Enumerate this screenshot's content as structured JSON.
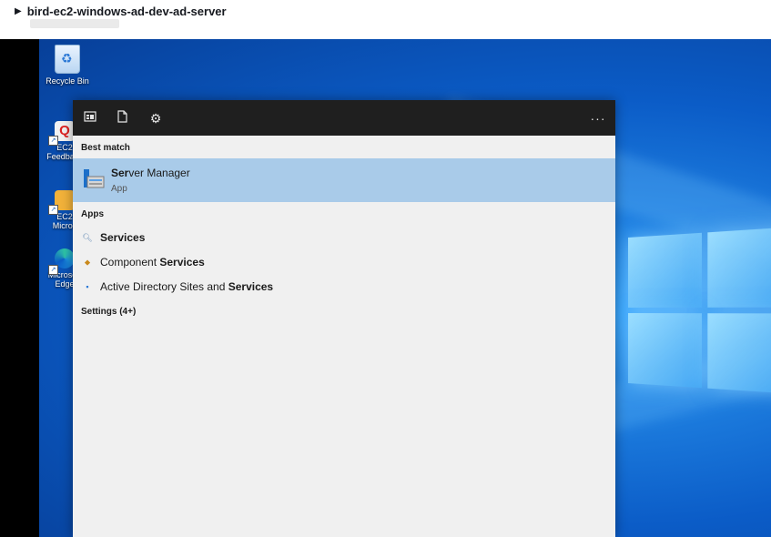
{
  "header": {
    "title": "bird-ec2-windows-ad-dev-ad-server"
  },
  "desktop": {
    "icons": [
      {
        "label": "Recycle Bin"
      },
      {
        "label": "EC2 Feedback"
      },
      {
        "label": "EC2 Micros"
      },
      {
        "label": "Microsoft Edge"
      }
    ]
  },
  "search_panel": {
    "best_match_heading": "Best match",
    "best_match": {
      "name_prefix": "Ser",
      "name_rest": "ver Manager",
      "type": "App"
    },
    "apps_heading": "Apps",
    "apps": [
      {
        "pre": "",
        "match": "Services",
        "post": ""
      },
      {
        "pre": "Component ",
        "match": "Services",
        "post": ""
      },
      {
        "pre": "Active Directory Sites and ",
        "match": "Services",
        "post": ""
      }
    ],
    "settings_heading": "Settings (4+)",
    "more_label": "···"
  },
  "colors": {
    "panel_bg": "#f0f0f0",
    "panel_toolbar": "#1f1f1f",
    "highlight": "#a9cbe9",
    "desktop_blue": "#0b5cc7"
  },
  "icon_names": [
    "apps-icon",
    "document-icon",
    "gear-icon",
    "more-options-icon",
    "server-manager-icon",
    "magnifier-icon",
    "component-services-icon",
    "ad-sites-icon"
  ]
}
